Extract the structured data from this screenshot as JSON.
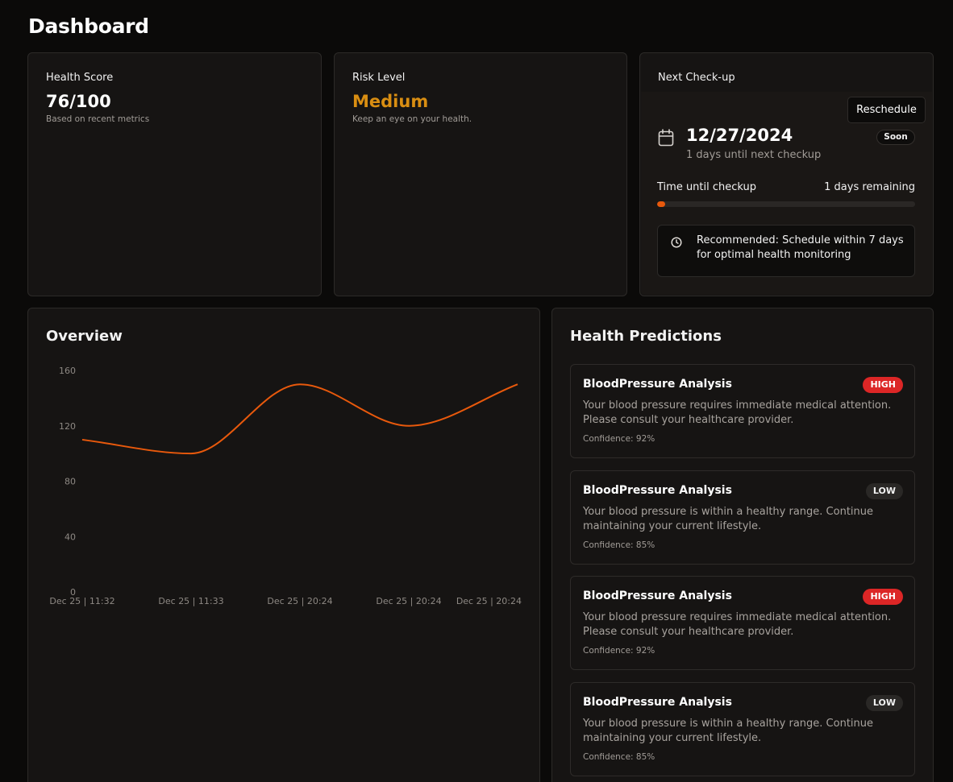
{
  "page": {
    "title": "Dashboard"
  },
  "health_score": {
    "label": "Health Score",
    "value": "76/100",
    "subtitle": "Based on recent metrics"
  },
  "risk_level": {
    "label": "Risk Level",
    "value": "Medium",
    "subtitle": "Keep an eye on your health.",
    "color": "#d98e12"
  },
  "next_checkup": {
    "label": "Next Check-up",
    "reschedule_label": "Reschedule",
    "date": "12/27/2024",
    "days_until_text": "1 days until next checkup",
    "badge": "Soon",
    "time_until_label": "Time until checkup",
    "remaining_text": "1 days remaining",
    "progress_percent": 3,
    "recommendation": "Recommended: Schedule within 7 days for optimal health monitoring",
    "accent_color": "#e8590c"
  },
  "overview": {
    "title": "Overview"
  },
  "chart_data": {
    "type": "line",
    "title": "",
    "xlabel": "",
    "ylabel": "",
    "x": [
      "Dec 25 | 11:32",
      "Dec 25 | 11:33",
      "Dec 25 | 20:24",
      "Dec 25 | 20:24",
      "Dec 25 | 20:24"
    ],
    "series": [
      {
        "values": [
          110,
          100,
          150,
          120,
          150
        ],
        "color": "#e8590c"
      }
    ],
    "yticks": [
      0,
      40,
      80,
      120,
      160
    ],
    "ylim": [
      0,
      160
    ],
    "grid": false,
    "curve": "smooth"
  },
  "predictions": {
    "title": "Health Predictions",
    "items": [
      {
        "title": "BloodPressure Analysis",
        "severity": "HIGH",
        "description": "Your blood pressure requires immediate medical attention. Please consult your healthcare provider.",
        "confidence": "Confidence: 92%"
      },
      {
        "title": "BloodPressure Analysis",
        "severity": "LOW",
        "description": "Your blood pressure is within a healthy range. Continue maintaining your current lifestyle.",
        "confidence": "Confidence: 85%"
      },
      {
        "title": "BloodPressure Analysis",
        "severity": "HIGH",
        "description": "Your blood pressure requires immediate medical attention. Please consult your healthcare provider.",
        "confidence": "Confidence: 92%"
      },
      {
        "title": "BloodPressure Analysis",
        "severity": "LOW",
        "description": "Your blood pressure is within a healthy range. Continue maintaining your current lifestyle.",
        "confidence": "Confidence: 85%"
      }
    ]
  },
  "icons": {
    "calendar": "calendar-icon",
    "clock": "clock-icon"
  }
}
